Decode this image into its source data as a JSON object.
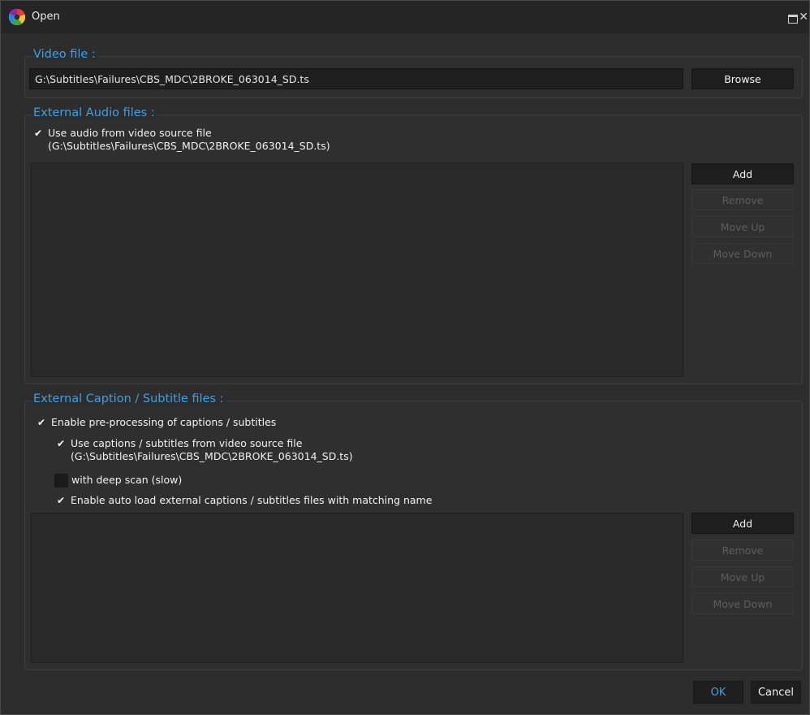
{
  "window": {
    "title": "Open"
  },
  "video": {
    "legend": "Video file :",
    "path": "G:\\Subtitles\\Failures\\CBS_MDC\\2BROKE_063014_SD.ts",
    "browse_label": "Browse"
  },
  "audio": {
    "legend": "External Audio files :",
    "use_source_label": "Use audio from video source file",
    "use_source_path": "(G:\\Subtitles\\Failures\\CBS_MDC\\2BROKE_063014_SD.ts)",
    "use_source_checked": true,
    "buttons": {
      "add": "Add",
      "remove": "Remove",
      "move_up": "Move Up",
      "move_down": "Move Down"
    }
  },
  "captions": {
    "legend": "External Caption / Subtitle files :",
    "enable_preprocessing_label": "Enable pre-processing of captions / subtitles",
    "enable_preprocessing_checked": true,
    "use_source_label": "Use captions / subtitles from video source file",
    "use_source_path": "(G:\\Subtitles\\Failures\\CBS_MDC\\2BROKE_063014_SD.ts)",
    "use_source_checked": true,
    "deep_scan_label": "with deep scan (slow)",
    "deep_scan_checked": false,
    "auto_load_label": "Enable auto load external captions / subtitles files with matching name",
    "auto_load_checked": true,
    "buttons": {
      "add": "Add",
      "remove": "Remove",
      "move_up": "Move Up",
      "move_down": "Move Down"
    }
  },
  "footer": {
    "ok_label": "OK",
    "cancel_label": "Cancel"
  },
  "colors": {
    "accent": "#3ea0e6",
    "background": "#2d2d2d",
    "titlebar": "#252525"
  },
  "icons": {
    "app": "app-logo-icon",
    "check": "checkmark-icon",
    "maximize": "maximize-icon",
    "close": "close-icon"
  }
}
